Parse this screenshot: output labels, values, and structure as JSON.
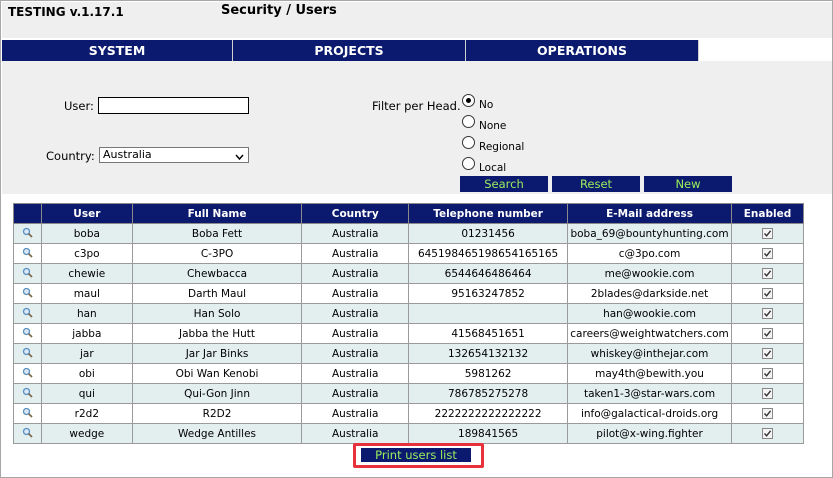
{
  "header": {
    "version": "TESTING v.1.17.1",
    "title": "Security / Users"
  },
  "menu": [
    "SYSTEM",
    "PROJECTS",
    "OPERATIONS"
  ],
  "filters": {
    "user_label": "User:",
    "user_value": "",
    "country_label": "Country:",
    "country_value": "Australia",
    "head_label": "Filter per Head.",
    "head_options": [
      "No",
      "None",
      "Regional",
      "Local"
    ],
    "head_selected": "No"
  },
  "buttons": {
    "search": "Search",
    "reset": "Reset",
    "new": "New",
    "print": "Print users list"
  },
  "table": {
    "headers": [
      "",
      "User",
      "Full Name",
      "Country",
      "Telephone number",
      "E-Mail address",
      "Enabled"
    ],
    "rows": [
      {
        "user": "boba",
        "full_name": "Boba Fett",
        "country": "Australia",
        "phone": "01231456",
        "email": "boba_69@bountyhunting.com",
        "enabled": true
      },
      {
        "user": "c3po",
        "full_name": "C-3PO",
        "country": "Australia",
        "phone": "645198465198654165165",
        "email": "c@3po.com",
        "enabled": true
      },
      {
        "user": "chewie",
        "full_name": "Chewbacca",
        "country": "Australia",
        "phone": "6544646486464",
        "email": "me@wookie.com",
        "enabled": true
      },
      {
        "user": "maul",
        "full_name": "Darth Maul",
        "country": "Australia",
        "phone": "95163247852",
        "email": "2blades@darkside.net",
        "enabled": true
      },
      {
        "user": "han",
        "full_name": "Han Solo",
        "country": "Australia",
        "phone": "",
        "email": "han@wookie.com",
        "enabled": true
      },
      {
        "user": "jabba",
        "full_name": "Jabba the Hutt",
        "country": "Australia",
        "phone": "41568451651",
        "email": "careers@weightwatchers.com",
        "enabled": true
      },
      {
        "user": "jar",
        "full_name": "Jar Jar Binks",
        "country": "Australia",
        "phone": "132654132132",
        "email": "whiskey@inthejar.com",
        "enabled": true
      },
      {
        "user": "obi",
        "full_name": "Obi Wan Kenobi",
        "country": "Australia",
        "phone": "5981262",
        "email": "may4th@bewith.you",
        "enabled": true
      },
      {
        "user": "qui",
        "full_name": "Qui-Gon Jinn",
        "country": "Australia",
        "phone": "786785275278",
        "email": "taken1-3@star-wars.com",
        "enabled": true
      },
      {
        "user": "r2d2",
        "full_name": "R2D2",
        "country": "Australia",
        "phone": "2222222222222222",
        "email": "info@galactical-droids.org",
        "enabled": true
      },
      {
        "user": "wedge",
        "full_name": "Wedge Antilles",
        "country": "Australia",
        "phone": "189841565",
        "email": "pilot@x-wing.fighter",
        "enabled": true
      }
    ]
  },
  "icons": {
    "row_action": "magnifier-icon",
    "dropdown": "chevron-down-icon",
    "enabled": "checkbox-checked-icon"
  },
  "colors": {
    "nav": "#0b1a6e",
    "button_text": "#9af05c",
    "highlight": "#e8323b",
    "row_alt": "#e3eeee"
  }
}
